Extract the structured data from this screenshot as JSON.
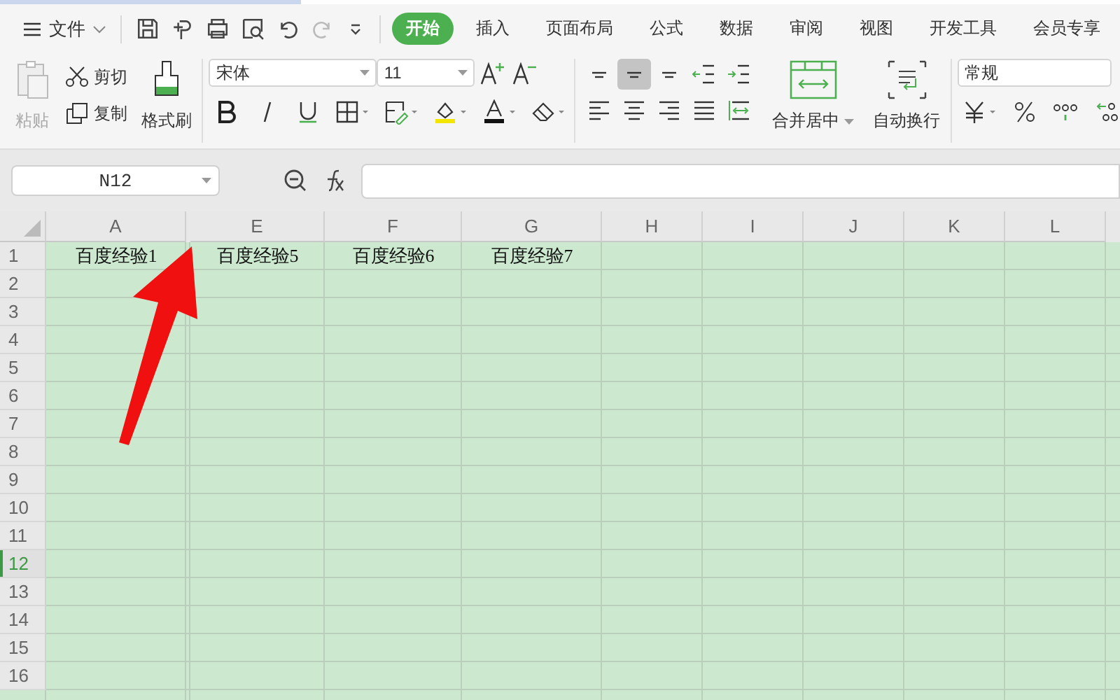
{
  "menu": {
    "label": "文件"
  },
  "tabs": [
    {
      "label": "开始",
      "selected": true
    },
    {
      "label": "插入",
      "selected": false
    },
    {
      "label": "页面布局",
      "selected": false
    },
    {
      "label": "公式",
      "selected": false
    },
    {
      "label": "数据",
      "selected": false
    },
    {
      "label": "审阅",
      "selected": false
    },
    {
      "label": "视图",
      "selected": false
    },
    {
      "label": "开发工具",
      "selected": false
    },
    {
      "label": "会员专享",
      "selected": false
    }
  ],
  "clipboard": {
    "paste": {
      "label": "粘贴",
      "disabled": true
    },
    "cut": "剪切",
    "copy": "复制",
    "format_painter": "格式刷"
  },
  "font": {
    "name": "宋体",
    "size": "11"
  },
  "align_buttons": [
    {
      "kind": "top",
      "selected": false
    },
    {
      "kind": "middle",
      "selected": true
    },
    {
      "kind": "bottom",
      "selected": false
    },
    {
      "kind": "outdent",
      "selected": false
    },
    {
      "kind": "indent",
      "selected": false
    },
    {
      "kind": "left",
      "selected": false
    },
    {
      "kind": "center",
      "selected": false
    },
    {
      "kind": "right",
      "selected": false
    },
    {
      "kind": "justify",
      "selected": false
    },
    {
      "kind": "distribute",
      "selected": false
    }
  ],
  "merge": "合并居中",
  "wrap": "自动换行",
  "number_format": "常规",
  "name_box": "N12",
  "columns": [
    "A",
    "E",
    "F",
    "G",
    "H",
    "I",
    "J",
    "K",
    "L"
  ],
  "rows": [
    {
      "number": "1",
      "selected": false,
      "cells": [
        "百度经验1",
        "百度经验5",
        "百度经验6",
        "百度经验7"
      ]
    },
    {
      "number": "2",
      "selected": false,
      "cells": []
    },
    {
      "number": "3",
      "selected": false,
      "cells": []
    },
    {
      "number": "4",
      "selected": false,
      "cells": []
    },
    {
      "number": "5",
      "selected": false,
      "cells": []
    },
    {
      "number": "6",
      "selected": false,
      "cells": []
    },
    {
      "number": "7",
      "selected": false,
      "cells": []
    },
    {
      "number": "8",
      "selected": false,
      "cells": []
    },
    {
      "number": "9",
      "selected": false,
      "cells": []
    },
    {
      "number": "10",
      "selected": false,
      "cells": []
    },
    {
      "number": "11",
      "selected": false,
      "cells": []
    },
    {
      "number": "12",
      "selected": true,
      "cells": []
    },
    {
      "number": "13",
      "selected": false,
      "cells": []
    },
    {
      "number": "14",
      "selected": false,
      "cells": []
    },
    {
      "number": "15",
      "selected": false,
      "cells": []
    },
    {
      "number": "16",
      "selected": false,
      "cells": []
    }
  ]
}
